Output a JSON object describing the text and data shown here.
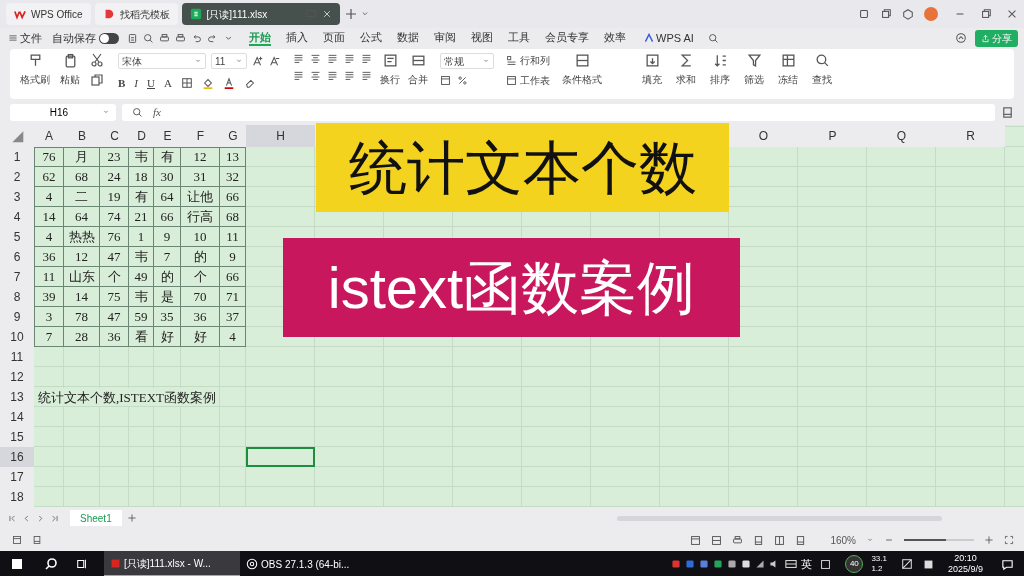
{
  "tabs": [
    {
      "label": "WPS Office",
      "kind": "home",
      "selected": false
    },
    {
      "label": "找稻壳模板",
      "kind": "docer",
      "selected": false
    },
    {
      "label": "[只读]111.xlsx",
      "kind": "sheet",
      "selected": true
    }
  ],
  "menu": {
    "file": "文件",
    "autosave": {
      "label": "自动保存",
      "on": false
    },
    "tabs": [
      {
        "label": "开始",
        "selected": true
      },
      {
        "label": "插入",
        "selected": false
      },
      {
        "label": "页面",
        "selected": false
      },
      {
        "label": "公式",
        "selected": false
      },
      {
        "label": "数据",
        "selected": false
      },
      {
        "label": "审阅",
        "selected": false
      },
      {
        "label": "视图",
        "selected": false
      },
      {
        "label": "工具",
        "selected": false
      },
      {
        "label": "会员专享",
        "selected": false
      },
      {
        "label": "效率",
        "selected": false
      }
    ],
    "ai": "WPS AI",
    "share": "分享"
  },
  "ribbon": {
    "clipboard": [
      "格式刷",
      "粘贴"
    ],
    "font": "宋体",
    "size": "11",
    "styles": [
      "B",
      "I",
      "U",
      "A"
    ],
    "align": [
      "换行",
      "合并"
    ],
    "number_format": "常规",
    "cells": [
      "行和列",
      "工作表"
    ],
    "conditional": "条件格式",
    "tools": [
      "填充",
      "求和",
      "排序",
      "筛选",
      "冻结",
      "查找"
    ]
  },
  "name_box": "H16",
  "fx": "fx",
  "columns": [
    {
      "label": "A",
      "selected": false
    },
    {
      "label": "B",
      "selected": false
    },
    {
      "label": "C",
      "selected": false
    },
    {
      "label": "D",
      "selected": false
    },
    {
      "label": "E",
      "selected": false
    },
    {
      "label": "F",
      "selected": false
    },
    {
      "label": "G",
      "selected": false
    },
    {
      "label": "H",
      "selected": true
    },
    {
      "label": "O",
      "selected": false
    },
    {
      "label": "P",
      "selected": false
    },
    {
      "label": "Q",
      "selected": false
    },
    {
      "label": "R",
      "selected": false
    }
  ],
  "rows": [
    {
      "header": "1",
      "selected": false,
      "cells": [
        "76",
        "月",
        "23",
        "韦",
        "有",
        "12",
        "13"
      ]
    },
    {
      "header": "2",
      "selected": false,
      "cells": [
        "62",
        "68",
        "24",
        "18",
        "30",
        "31",
        "32"
      ]
    },
    {
      "header": "3",
      "selected": false,
      "cells": [
        "4",
        "二",
        "19",
        "有",
        "64",
        "让他",
        "66"
      ]
    },
    {
      "header": "4",
      "selected": false,
      "cells": [
        "14",
        "64",
        "74",
        "21",
        "66",
        "行高",
        "68"
      ]
    },
    {
      "header": "5",
      "selected": false,
      "cells": [
        "4",
        "热热",
        "76",
        "1",
        "9",
        "10",
        "11"
      ]
    },
    {
      "header": "6",
      "selected": false,
      "cells": [
        "36",
        "12",
        "47",
        "韦",
        "7",
        "的",
        "9"
      ]
    },
    {
      "header": "7",
      "selected": false,
      "cells": [
        "11",
        "山东",
        "个",
        "49",
        "的",
        "个",
        "66"
      ]
    },
    {
      "header": "8",
      "selected": false,
      "cells": [
        "39",
        "14",
        "75",
        "韦",
        "是",
        "70",
        "71"
      ]
    },
    {
      "header": "9",
      "selected": false,
      "cells": [
        "3",
        "78",
        "47",
        "59",
        "35",
        "36",
        "37"
      ]
    },
    {
      "header": "10",
      "selected": false,
      "cells": [
        "7",
        "28",
        "36",
        "看",
        "好",
        "好",
        "4"
      ]
    },
    {
      "header": "11",
      "selected": false
    },
    {
      "header": "12",
      "selected": false
    },
    {
      "header": "13",
      "selected": false,
      "note": "统计文本个数,ISTEXT函数案例"
    },
    {
      "header": "14",
      "selected": false
    },
    {
      "header": "15",
      "selected": false
    },
    {
      "header": "16",
      "selected": true
    },
    {
      "header": "17",
      "selected": false
    },
    {
      "header": "18",
      "selected": false
    }
  ],
  "banners": [
    {
      "text": "统计文本个数",
      "color": "#f4d31f"
    },
    {
      "text": "istext函数案例",
      "color": "#c8175c"
    }
  ],
  "sheets": [
    {
      "label": "Sheet1",
      "selected": true
    }
  ],
  "status": {
    "zoom": "160%",
    "zoom_slider": {
      "level": 0.6
    }
  },
  "taskbar": {
    "apps": [
      {
        "label": "[只读]111.xlsx - W...",
        "kind": "wps",
        "selected": true
      },
      {
        "label": "OBS 27.1.3 (64-bi...",
        "kind": "obs",
        "selected": false
      }
    ],
    "ime": "英",
    "badge": "40",
    "net_up": "33.1",
    "net_down": "1.2",
    "time": "20:10",
    "date": "2025/9/9"
  }
}
